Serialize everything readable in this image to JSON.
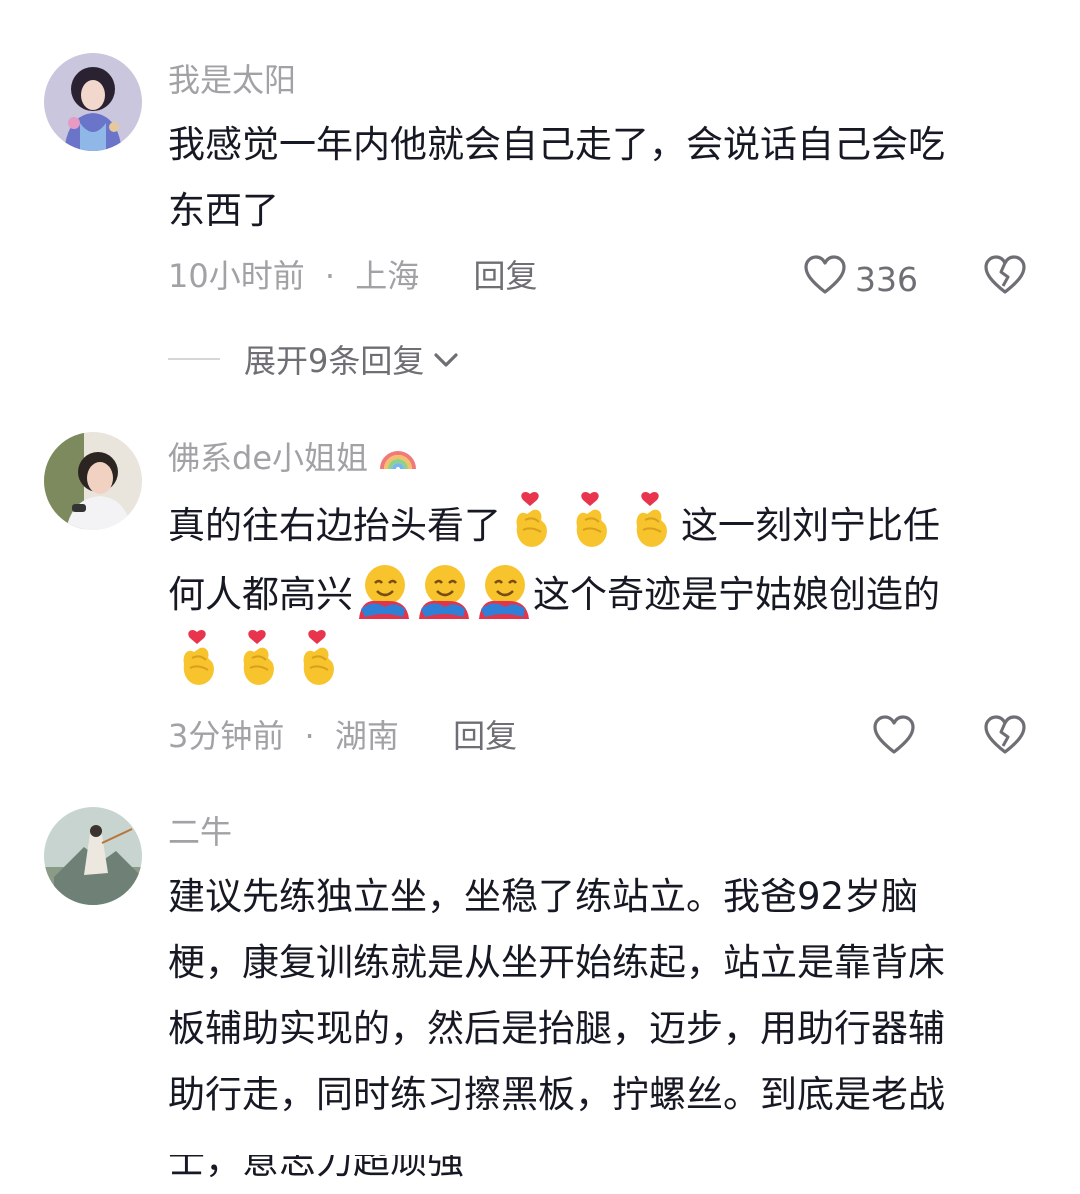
{
  "comments": [
    {
      "username": "我是太阳",
      "text_lines": [
        "我感觉一年内他就会自己走了，会说话自己会吃",
        "东西了"
      ],
      "time": "10小时前",
      "location": "上海",
      "reply_label": "回复",
      "like_count": "336",
      "expand_label": "展开9条回复"
    },
    {
      "username": "佛系de小姐姐",
      "username_emoji": "rainbow",
      "text_part1": "真的往右边抬头看了",
      "emoji_heart_hands": "finger-heart",
      "text_part2": "这一刻刘宁比任",
      "text_part3": "何人都高兴",
      "emoji_hug": "hugging-face",
      "text_part4": "这个奇迹是宁姑娘创造的",
      "time": "3分钟前",
      "location": "湖南",
      "reply_label": "回复"
    },
    {
      "username": "二牛",
      "text_lines": [
        "建议先练独立坐，坐稳了练站立。我爸92岁脑",
        "梗，康复训练就是从坐开始练起，站立是靠背床",
        "板辅助实现的，然后是抬腿，迈步，用助行器辅",
        "助行走，同时练习擦黑板，拧螺丝。到底是老战",
        "士，意志力超顽强"
      ]
    }
  ],
  "separator": "·",
  "icons": {
    "like": "heart-outline-icon",
    "dislike": "broken-heart-icon",
    "expand": "chevron-down-icon"
  },
  "colors": {
    "text": "#161823",
    "muted": "#a2a2a6",
    "secondary": "#6e6e74"
  }
}
